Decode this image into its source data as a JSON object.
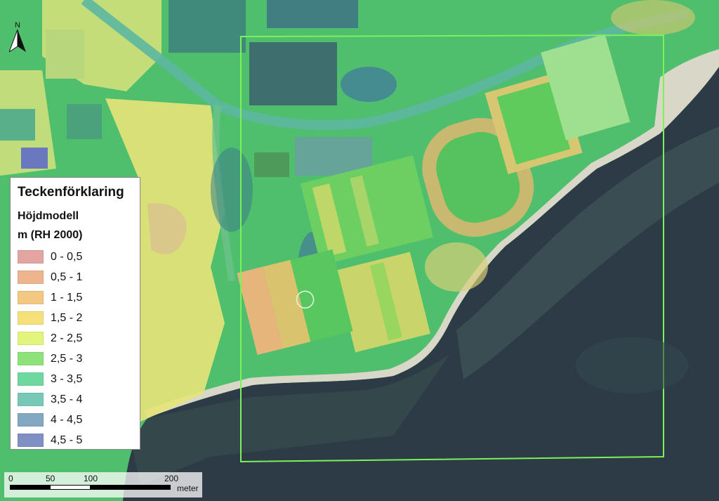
{
  "map": {
    "north_label": "N"
  },
  "legend": {
    "title": "Teckenförklaring",
    "layer": "Höjdmodell",
    "unit": "m (RH 2000)",
    "items": [
      {
        "label": "0 - 0,5",
        "color": "#e3a5a2"
      },
      {
        "label": "0,5 - 1",
        "color": "#eeb48d"
      },
      {
        "label": "1 - 1,5",
        "color": "#f2c882"
      },
      {
        "label": "1,5 - 2",
        "color": "#f5e07a"
      },
      {
        "label": "2 - 2,5",
        "color": "#e2f47b"
      },
      {
        "label": "2,5 - 3",
        "color": "#8ee27a"
      },
      {
        "label": "3 - 3,5",
        "color": "#6fd8a0"
      },
      {
        "label": "3,5 - 4",
        "color": "#78c8b6"
      },
      {
        "label": "4 - 4,5",
        "color": "#82a8c2"
      },
      {
        "label": "4,5 - 5",
        "color": "#8090c4"
      }
    ]
  },
  "scalebar": {
    "ticks": [
      "0",
      "50",
      "100",
      "200"
    ],
    "unit": "meter"
  }
}
